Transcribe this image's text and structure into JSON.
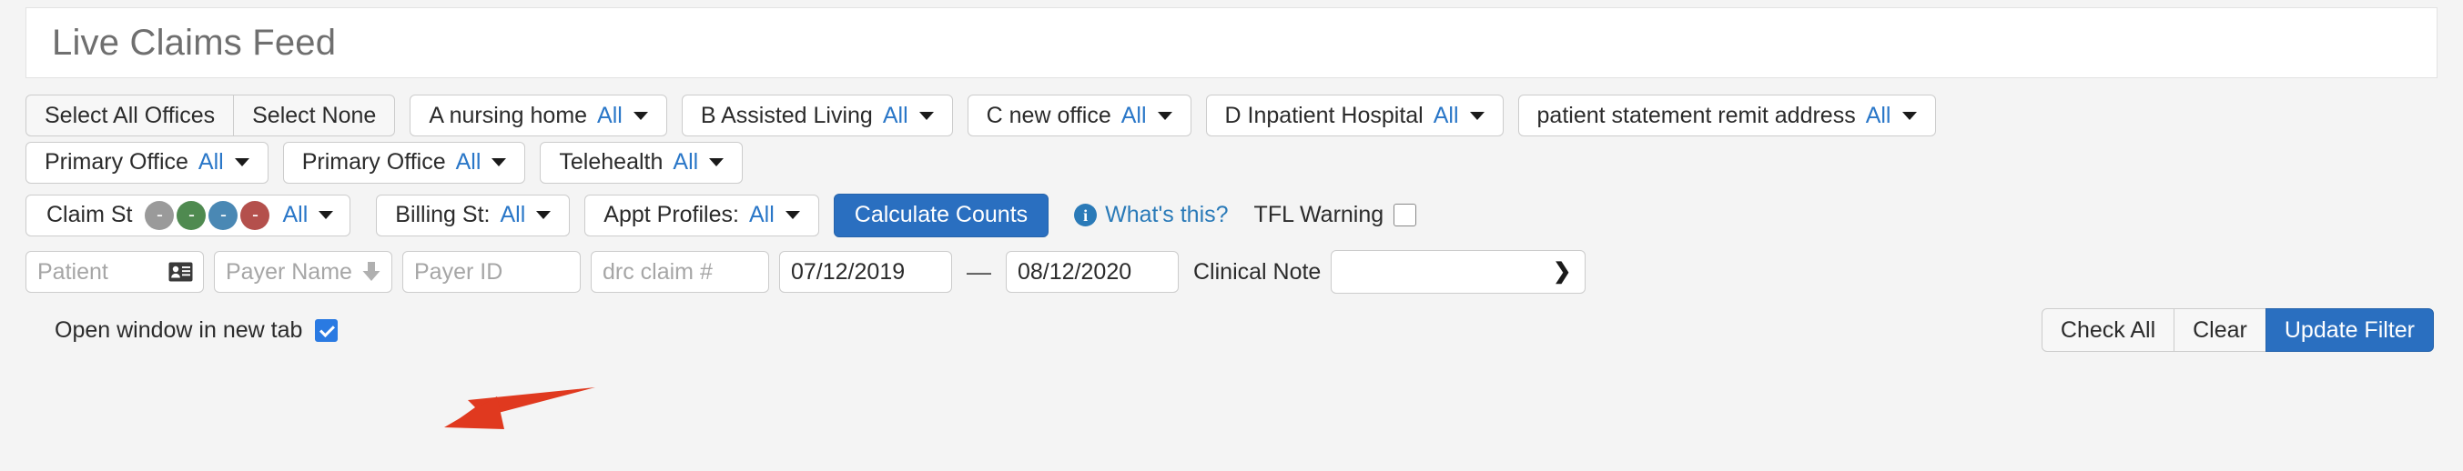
{
  "header": {
    "title": "Live Claims Feed"
  },
  "office_controls": {
    "select_all_label": "Select All Offices",
    "select_none_label": "Select None"
  },
  "office_filters": [
    {
      "label": "A nursing home",
      "value": "All",
      "icon": "chevron-down-icon"
    },
    {
      "label": "B Assisted Living",
      "value": "All",
      "icon": "chevron-down-icon"
    },
    {
      "label": "C new office",
      "value": "All",
      "icon": "chevron-down-icon"
    },
    {
      "label": "D Inpatient Hospital",
      "value": "All",
      "icon": "chevron-down-icon"
    },
    {
      "label": "patient statement remit address",
      "value": "All",
      "icon": "chevron-down-icon"
    }
  ],
  "provider_filters": [
    {
      "label": "Primary Office",
      "value": "All",
      "icon": "chevron-down-icon"
    },
    {
      "label": "Primary Office",
      "value": "All",
      "icon": "chevron-down-icon"
    },
    {
      "label": "Telehealth",
      "value": "All",
      "icon": "chevron-down-icon"
    }
  ],
  "status_row": {
    "claim_status": {
      "label": "Claim St",
      "value": "All",
      "dots": [
        {
          "name": "status-dot-gray",
          "color": "#9a9a9a",
          "glyph": "-"
        },
        {
          "name": "status-dot-green",
          "color": "#4f8a50",
          "glyph": "-"
        },
        {
          "name": "status-dot-blue",
          "color": "#4a88b4",
          "glyph": "-"
        },
        {
          "name": "status-dot-red",
          "color": "#b4504c",
          "glyph": "-"
        }
      ]
    },
    "billing_status": {
      "label": "Billing St:",
      "value": "All"
    },
    "appt_profiles": {
      "label": "Appt Profiles:",
      "value": "All"
    },
    "calculate_counts_label": "Calculate Counts",
    "whats_this_label": "What's this?",
    "whats_this_icon": "info-circle-icon",
    "tfl_warning_label": "TFL Warning",
    "tfl_warning_checked": false
  },
  "search_row": {
    "patient_placeholder": "Patient",
    "patient_value": "",
    "patient_icon": "contact-card-icon",
    "payer_name_placeholder": "Payer Name",
    "payer_name_value": "",
    "payer_name_icon": "arrow-down-icon",
    "payer_id_placeholder": "Payer ID",
    "payer_id_value": "",
    "claim_num_placeholder": "drc claim #",
    "claim_num_value": "",
    "date_from": "07/12/2019",
    "date_separator": "—",
    "date_to": "08/12/2020",
    "clinical_note_label": "Clinical Note",
    "clinical_note_value": "",
    "clinical_note_icon": "chevron-down-icon"
  },
  "footer": {
    "open_new_tab_label": "Open window in new tab",
    "open_new_tab_checked": true,
    "check_all_label": "Check All",
    "clear_label": "Clear",
    "update_filter_label": "Update Filter"
  },
  "annotation": {
    "arrow_color": "#e0391f",
    "points_at": "open-window-in-new-tab-checkbox"
  },
  "colors": {
    "primary_blue": "#2a6fc0",
    "link_blue": "#2a77c8",
    "panel_bg": "#f4f4f4",
    "border": "#cccccc"
  }
}
